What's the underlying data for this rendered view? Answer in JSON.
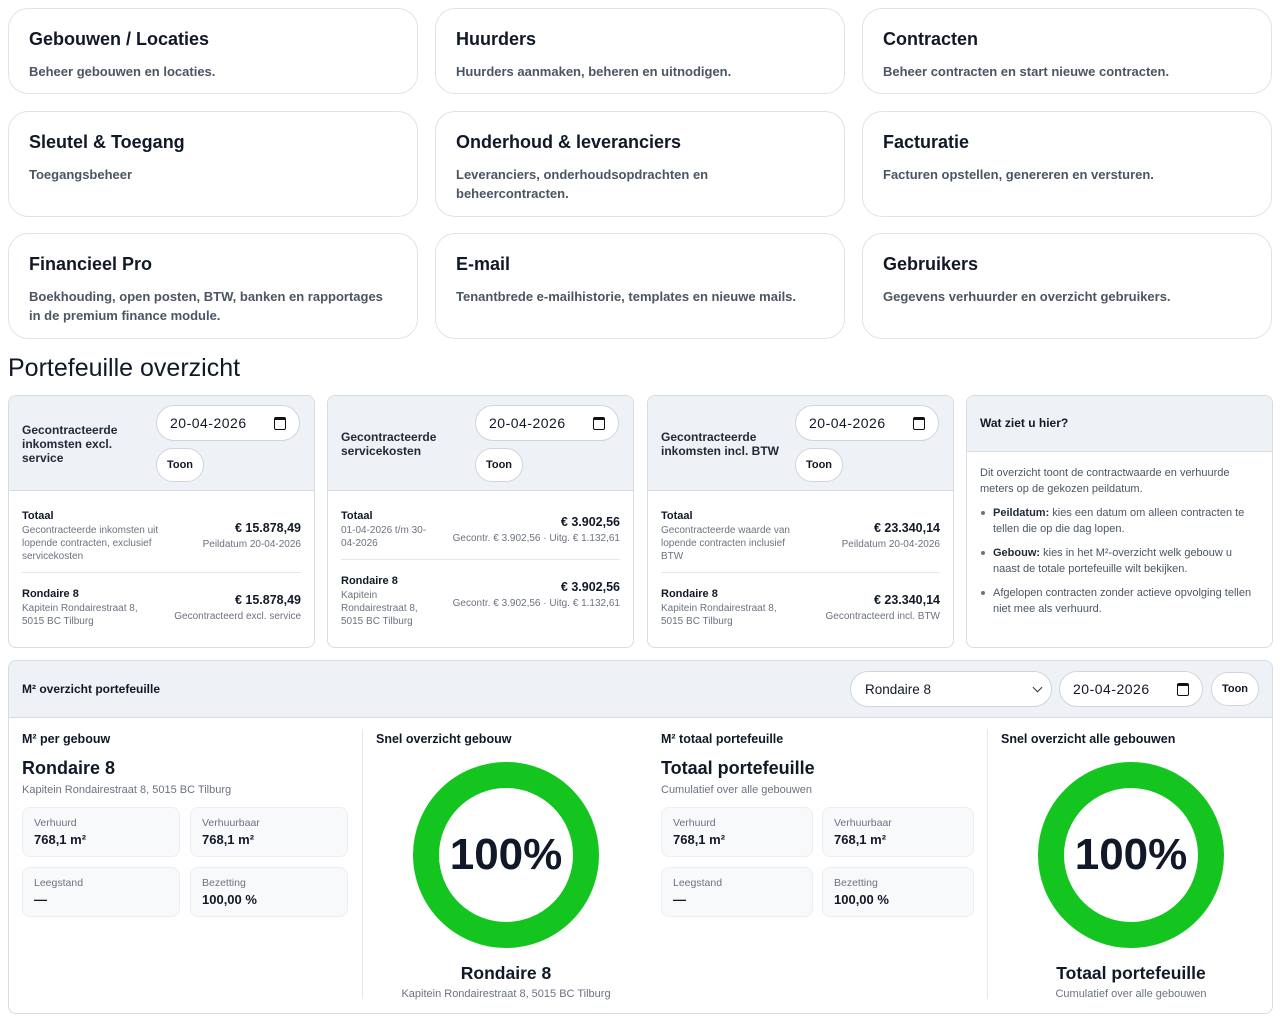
{
  "tiles": [
    {
      "title": "Gebouwen / Locaties",
      "desc": "Beheer gebouwen en locaties."
    },
    {
      "title": "Huurders",
      "desc": "Huurders aanmaken, beheren en uitnodigen."
    },
    {
      "title": "Contracten",
      "desc": "Beheer contracten en start nieuwe contracten."
    },
    {
      "title": "Sleutel & Toegang",
      "desc": "Toegangsbeheer"
    },
    {
      "title": "Onderhoud & leveranciers",
      "desc": "Leveranciers, onderhoudsopdrachten en beheercontracten."
    },
    {
      "title": "Facturatie",
      "desc": "Facturen opstellen, genereren en versturen."
    },
    {
      "title": "Financieel Pro",
      "desc": "Boekhouding, open posten, BTW, banken en rapportages in de premium finance module."
    },
    {
      "title": "E-mail",
      "desc": "Tenantbrede e-mailhistorie, templates en nieuwe mails."
    },
    {
      "title": "Gebruikers",
      "desc": "Gegevens verhuurder en overzicht gebruikers."
    }
  ],
  "section_title": "Portefeuille overzicht",
  "cards": [
    {
      "title": "Gecontracteerde inkomsten excl. service",
      "date": "20-04-2026",
      "button": "Toon",
      "total_label": "Totaal",
      "total_sub": "Gecontracteerde inkomsten uit lopende contracten, exclusief servicekosten",
      "total_amount": "€ 15.878,49",
      "total_meta": "Peildatum 20-04-2026",
      "row_label": "Rondaire 8",
      "row_sub": "Kapitein Rondairestraat 8, 5015 BC Tilburg",
      "row_amount": "€ 15.878,49",
      "row_meta": "Gecontracteerd excl. service"
    },
    {
      "title": "Gecontracteerde servicekosten",
      "date": "20-04-2026",
      "button": "Toon",
      "total_label": "Totaal",
      "total_sub": "01-04-2026 t/m 30-04-2026",
      "total_amount": "€ 3.902,56",
      "total_meta": "Gecontr. € 3.902,56 · Uitg. € 1.132,61",
      "row_label": "Rondaire 8",
      "row_sub": "Kapitein Rondairestraat 8, 5015 BC Tilburg",
      "row_amount": "€ 3.902,56",
      "row_meta": "Gecontr. € 3.902,56 · Uitg. € 1.132,61"
    },
    {
      "title": "Gecontracteerde inkomsten incl. BTW",
      "date": "20-04-2026",
      "button": "Toon",
      "total_label": "Totaal",
      "total_sub": "Gecontracteerde waarde van lopende contracten inclusief BTW",
      "total_amount": "€ 23.340,14",
      "total_meta": "Peildatum 20-04-2026",
      "row_label": "Rondaire 8",
      "row_sub": "Kapitein Rondairestraat 8, 5015 BC Tilburg",
      "row_amount": "€ 23.340,14",
      "row_meta": "Gecontracteerd incl. BTW"
    }
  ],
  "info": {
    "title": "Wat ziet u hier?",
    "intro": "Dit overzicht toont de contractwaarde en verhuurde meters op de gekozen peildatum.",
    "items": [
      {
        "bold": "Peildatum:",
        "text": " kies een datum om alleen contracten te tellen die op die dag lopen."
      },
      {
        "bold": "Gebouw:",
        "text": " kies in het M²-overzicht welk gebouw u naast de totale portefeuille wilt bekijken."
      },
      {
        "bold": "",
        "text": "Afgelopen contracten zonder actieve opvolging tellen niet mee als verhuurd."
      }
    ]
  },
  "m2": {
    "title": "M² overzicht portefeuille",
    "select_value": "Rondaire 8",
    "date": "20-04-2026",
    "button": "Toon",
    "building": {
      "header": "M² per gebouw",
      "name": "Rondaire 8",
      "address": "Kapitein Rondairestraat 8, 5015 BC Tilburg",
      "stats": [
        {
          "label": "Verhuurd",
          "value": "768,1 m²"
        },
        {
          "label": "Verhuurbaar",
          "value": "768,1 m²"
        },
        {
          "label": "Leegstand",
          "value": "—"
        },
        {
          "label": "Bezetting",
          "value": "100,00 %"
        }
      ]
    },
    "quick_building": {
      "header": "Snel overzicht gebouw",
      "percent": "100%",
      "name": "Rondaire 8",
      "address": "Kapitein Rondairestraat 8, 5015 BC Tilburg"
    },
    "portfolio": {
      "header": "M² totaal portefeuille",
      "name": "Totaal portefeuille",
      "sub": "Cumulatief over alle gebouwen",
      "stats": [
        {
          "label": "Verhuurd",
          "value": "768,1 m²"
        },
        {
          "label": "Verhuurbaar",
          "value": "768,1 m²"
        },
        {
          "label": "Leegstand",
          "value": "—"
        },
        {
          "label": "Bezetting",
          "value": "100,00 %"
        }
      ]
    },
    "quick_all": {
      "header": "Snel overzicht alle gebouwen",
      "percent": "100%",
      "name": "Totaal portefeuille",
      "sub": "Cumulatief over alle gebouwen"
    },
    "ring_color": "#14c41f"
  }
}
